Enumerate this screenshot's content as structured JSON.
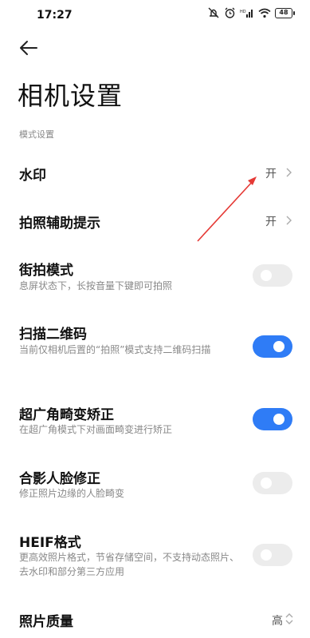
{
  "status_bar": {
    "time": "17:27",
    "battery": "48"
  },
  "header": {
    "title": "相机设置"
  },
  "section": {
    "label": "模式设置"
  },
  "rows": {
    "watermark": {
      "title": "水印",
      "value": "开"
    },
    "assist": {
      "title": "拍照辅助提示",
      "value": "开"
    },
    "street": {
      "title": "街拍模式",
      "subtitle": "息屏状态下，长按音量下键即可拍照",
      "toggle_on": false
    },
    "qr": {
      "title": "扫描二维码",
      "subtitle": "当前仅相机后置的“拍照”模式支持二维码扫描",
      "toggle_on": true
    },
    "ultrawide": {
      "title": "超广角畸变矫正",
      "subtitle": "在超广角模式下对画面畸变进行矫正",
      "toggle_on": true
    },
    "face": {
      "title": "合影人脸修正",
      "subtitle": "修正照片边缘的人脸畸变",
      "toggle_on": false
    },
    "heif": {
      "title": "HEIF格式",
      "subtitle": "更高效照片格式，节省存储空间，不支持动态照片、去水印和部分第三方应用",
      "toggle_on": false
    },
    "quality": {
      "title": "照片质量",
      "value": "高"
    }
  },
  "colors": {
    "accent": "#2f7cf6",
    "annotation_arrow": "#e53935"
  }
}
